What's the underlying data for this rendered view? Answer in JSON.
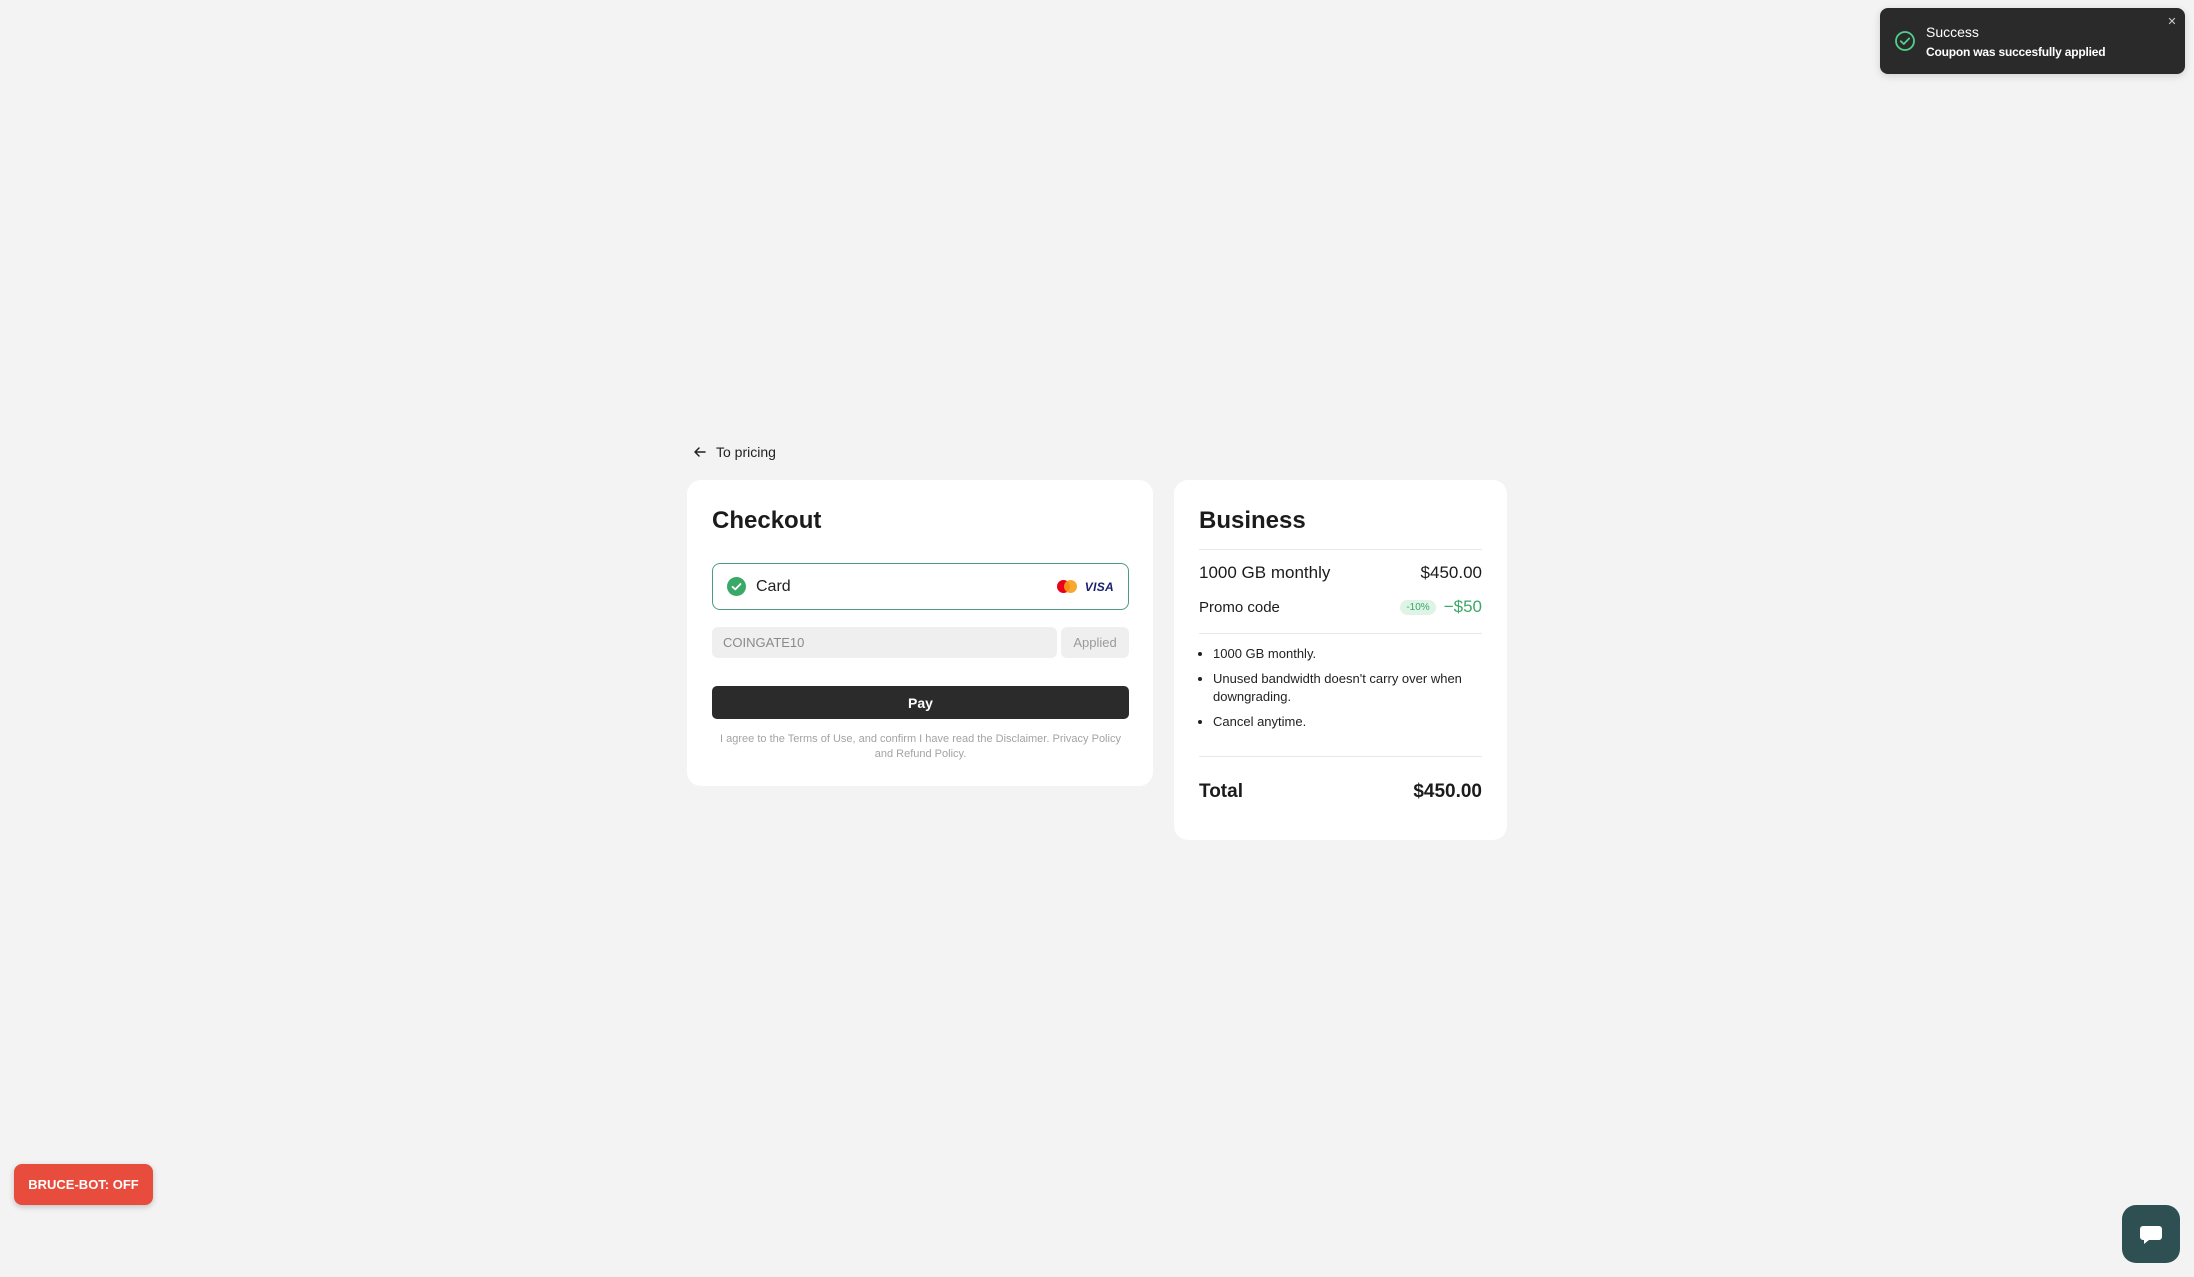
{
  "toast": {
    "title": "Success",
    "message": "Coupon was succesfully applied",
    "icon": "check-circle-icon",
    "close_icon": "close-icon"
  },
  "nav": {
    "back_label": "To pricing",
    "back_icon": "arrow-left-icon"
  },
  "checkout": {
    "title": "Checkout",
    "payment_method": {
      "label": "Card",
      "selected": true,
      "brands": [
        "mastercard-icon",
        "visa-icon"
      ],
      "visa_text": "VISA"
    },
    "coupon": {
      "value": "COINGATE10",
      "button_label": "Applied"
    },
    "pay_label": "Pay",
    "terms": {
      "prefix": "I agree to the",
      "terms_link": "Terms of Use",
      "middle": ", and confirm I have read the",
      "disclaimer_link": "Disclaimer",
      "sep": ".",
      "privacy_link": "Privacy Policy",
      "and": "and",
      "refund_link": "Refund Policy",
      "end": "."
    }
  },
  "summary": {
    "plan_name": "Business",
    "plan_line": "1000 GB monthly",
    "plan_price": "$450.00",
    "promo_label": "Promo code",
    "promo_badge": "-10%",
    "promo_amount": "−$50",
    "features": [
      "1000 GB monthly.",
      "Unused bandwidth doesn't carry over when downgrading.",
      "Cancel anytime."
    ],
    "total_label": "Total",
    "total_value": "$450.00"
  },
  "widgets": {
    "bot_label": "BRUCE-BOT: OFF",
    "chat_icon": "chat-bubble-icon"
  },
  "colors": {
    "accent_green": "#3aa866",
    "selected_border": "#4e9a88",
    "toast_bg": "#2a2a2a",
    "bot_red": "#e74c3c",
    "chat_bg": "#2f5052"
  }
}
